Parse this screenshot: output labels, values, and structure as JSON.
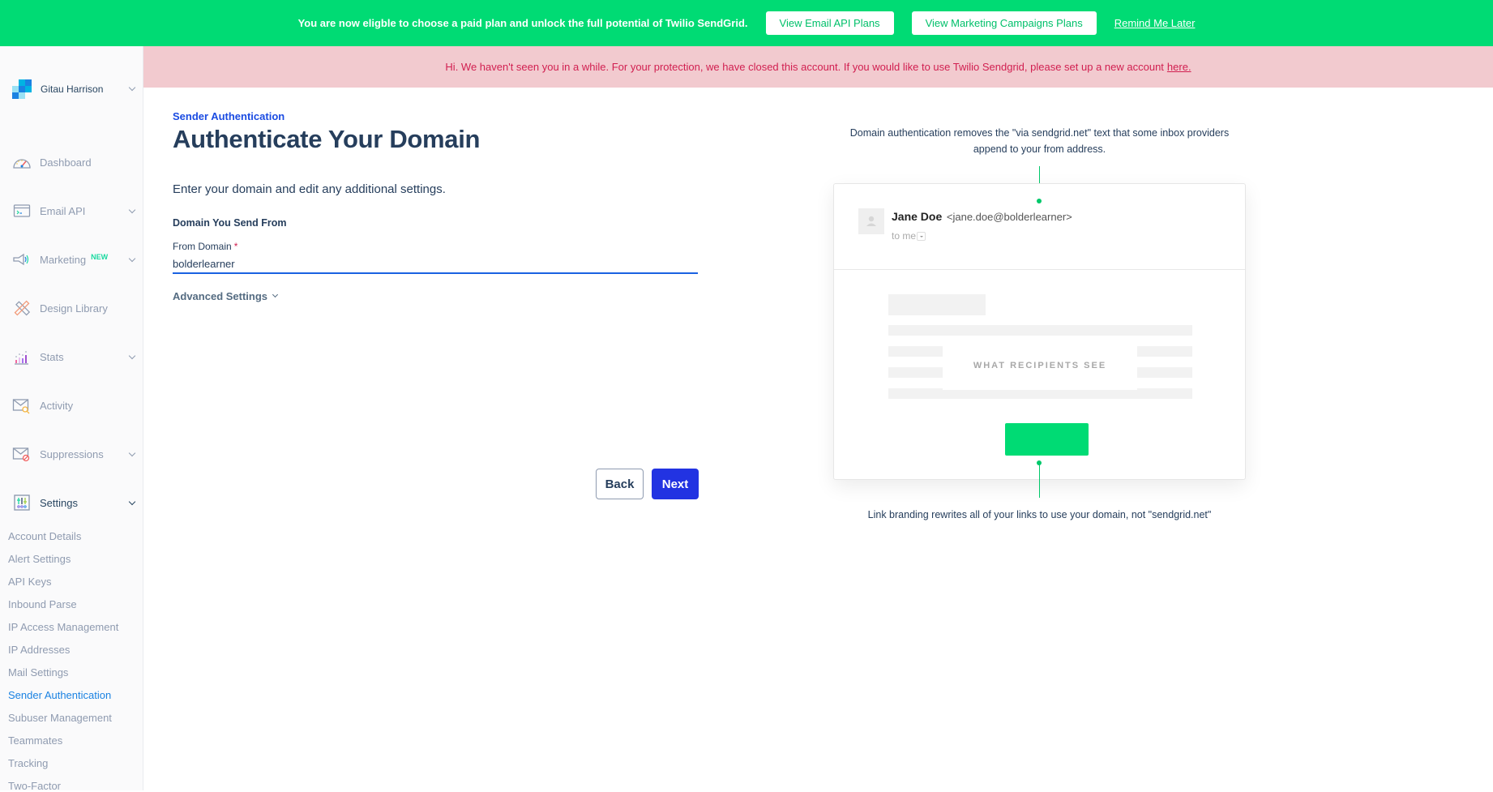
{
  "upgrade_banner": {
    "message": "You are now eligble to choose a paid plan and unlock the full potential of Twilio SendGrid.",
    "email_api_button": "View Email API Plans",
    "marketing_button": "View Marketing Campaigns Plans",
    "remind_link": "Remind Me Later"
  },
  "warning_banner": {
    "message": "Hi. We haven't seen you in a while. For your protection, we have closed this account. If you would like to use Twilio Sendgrid, please set up a new account",
    "link": "here."
  },
  "sidebar": {
    "account_name": "Gitau Harrison",
    "nav": [
      {
        "label": "Dashboard",
        "icon": "gauge-icon",
        "expandable": false
      },
      {
        "label": "Email API",
        "icon": "terminal-icon",
        "expandable": true
      },
      {
        "label": "Marketing",
        "icon": "megaphone-icon",
        "expandable": true,
        "badge": "NEW"
      },
      {
        "label": "Design Library",
        "icon": "pencil-ruler-icon",
        "expandable": false
      },
      {
        "label": "Stats",
        "icon": "bar-chart-icon",
        "expandable": true
      },
      {
        "label": "Activity",
        "icon": "mail-search-icon",
        "expandable": false
      },
      {
        "label": "Suppressions",
        "icon": "mail-blocked-icon",
        "expandable": true
      },
      {
        "label": "Settings",
        "icon": "sliders-icon",
        "expandable": true,
        "expanded": true
      }
    ],
    "settings_items": [
      {
        "label": "Account Details"
      },
      {
        "label": "Alert Settings"
      },
      {
        "label": "API Keys"
      },
      {
        "label": "Inbound Parse"
      },
      {
        "label": "IP Access Management"
      },
      {
        "label": "IP Addresses"
      },
      {
        "label": "Mail Settings"
      },
      {
        "label": "Sender Authentication",
        "active": true
      },
      {
        "label": "Subuser Management"
      },
      {
        "label": "Teammates"
      },
      {
        "label": "Tracking"
      },
      {
        "label": "Two-Factor"
      }
    ]
  },
  "main": {
    "breadcrumb": "Sender Authentication",
    "title": "Authenticate Your Domain",
    "intro": "Enter your domain and edit any additional settings.",
    "section_title": "Domain You Send From",
    "field_label": "From Domain",
    "required_mark": "*",
    "field_value": "bolderlearner",
    "advanced_settings": "Advanced Settings",
    "back_button": "Back",
    "next_button": "Next"
  },
  "illustration": {
    "caption_top": "Domain authentication removes the \"via sendgrid.net\" text that some inbox providers append to your from address.",
    "sender_name": "Jane Doe",
    "sender_email": "<jane.doe@bolderlearner>",
    "to_me": "to me",
    "overlay_label": "WHAT RECIPIENTS SEE",
    "caption_bottom": "Link branding rewrites all of your links to use your domain, not \"sendgrid.net\""
  },
  "colors": {
    "brand_green": "#00db74",
    "warning_bg": "#f2cacf",
    "warning_text": "#d11f50",
    "primary_blue": "#2233e2",
    "active_link": "#1a82e2"
  }
}
